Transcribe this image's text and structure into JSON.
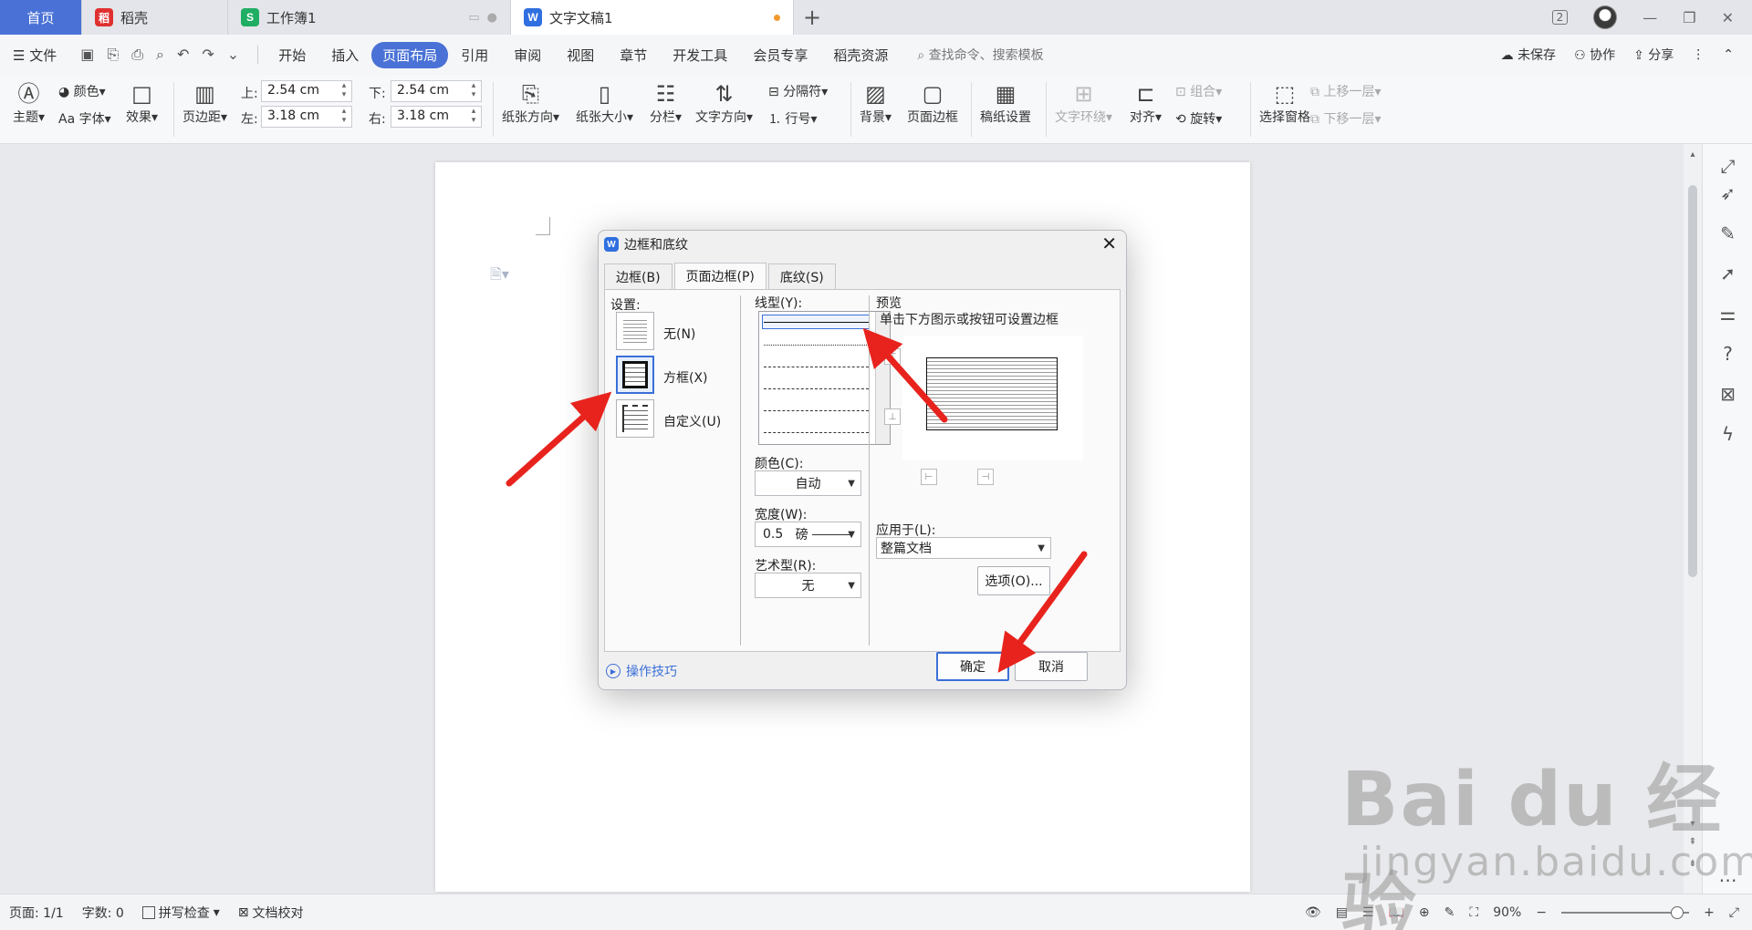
{
  "tabs": [
    {
      "label": "首页"
    },
    {
      "label": "稻壳",
      "icon_letter": "稻"
    },
    {
      "label": "工作簿1",
      "icon_letter": "S"
    },
    {
      "label": "文字文稿1",
      "icon_letter": "W"
    }
  ],
  "window": {
    "badge": "2"
  },
  "menu": {
    "file": "文件",
    "items": [
      "开始",
      "插入",
      "页面布局",
      "引用",
      "审阅",
      "视图",
      "章节",
      "开发工具",
      "会员专享",
      "稻壳资源"
    ],
    "active": "页面布局",
    "search": "查找命令、搜索模板",
    "unsaved": "未保存",
    "collab": "协作",
    "share": "分享"
  },
  "ribbon": {
    "theme": "主题",
    "color": "颜色",
    "font": "字体",
    "effect": "效果",
    "margins": "页边距",
    "top_label": "上:",
    "top_value": "2.54 cm",
    "bottom_label": "下:",
    "bottom_value": "2.54 cm",
    "left_label": "左:",
    "left_value": "3.18 cm",
    "right_label": "右:",
    "right_value": "3.18 cm",
    "orientation": "纸张方向",
    "size": "纸张大小",
    "columns": "分栏",
    "text_direction": "文字方向",
    "breaks": "分隔符",
    "line_numbers": "行号",
    "background": "背景",
    "page_border": "页面边框",
    "manuscript": "稿纸设置",
    "wrap": "文字环绕",
    "align": "对齐",
    "rotate": "旋转",
    "group": "组合",
    "selection_pane": "选择窗格",
    "bring_forward": "上移一层",
    "send_backward": "下移一层"
  },
  "dialog": {
    "title": "边框和底纹",
    "tabs": [
      "边框(B)",
      "页面边框(P)",
      "底纹(S)"
    ],
    "active_tab": "页面边框(P)",
    "setting_label": "设置:",
    "settings": [
      "无(N)",
      "方框(X)",
      "自定义(U)"
    ],
    "selected_setting": "方框(X)",
    "line_style_label": "线型(Y):",
    "color_label": "颜色(C):",
    "color_value": "自动",
    "width_label": "宽度(W):",
    "width_value": "0.5",
    "width_unit": "磅",
    "art_label": "艺术型(R):",
    "art_value": "无",
    "preview_label": "预览",
    "preview_hint": "单击下方图示或按钮可设置边框",
    "apply_label": "应用于(L):",
    "apply_value": "整篇文档",
    "options_button": "选项(O)...",
    "tips": "操作技巧",
    "ok": "确定",
    "cancel": "取消"
  },
  "status": {
    "page": "页面: 1/1",
    "words": "字数: 0",
    "spell": "拼写检查",
    "proof": "文档校对",
    "zoom": "90%"
  },
  "watermark": {
    "big": "Bai du 经验",
    "small": "jingyan.baidu.com"
  },
  "colors": {
    "accent": "#4a72d6",
    "arrow": "#e8231d"
  }
}
